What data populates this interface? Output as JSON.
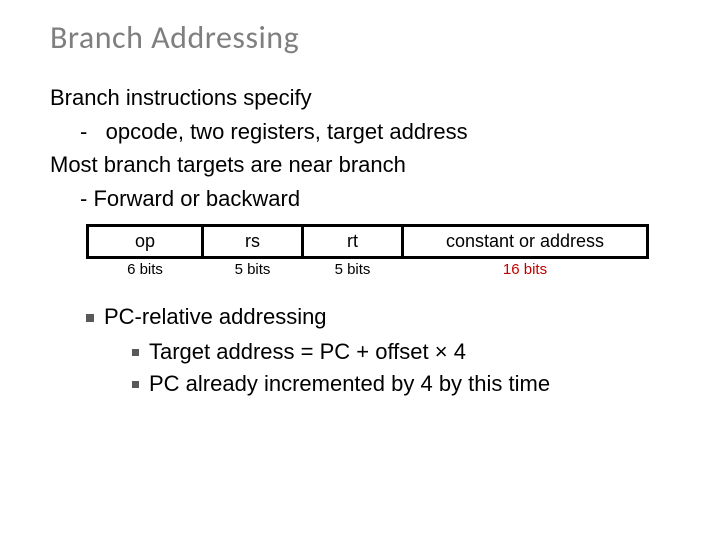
{
  "title": "Branch Addressing",
  "body": {
    "line1": "Branch instructions specify",
    "line1_sub": "-   opcode, two registers, target address",
    "line2": "Most branch targets are near branch",
    "line2_sub": "- Forward or backward"
  },
  "table": {
    "fields": [
      "op",
      "rs",
      "rt",
      "constant or address"
    ],
    "bits": [
      "6 bits",
      "5 bits",
      "5 bits",
      "16 bits"
    ]
  },
  "pc": {
    "main": "PC-relative addressing",
    "sub1": "Target address = PC + offset × 4",
    "sub2": "PC already incremented by 4 by this time"
  }
}
